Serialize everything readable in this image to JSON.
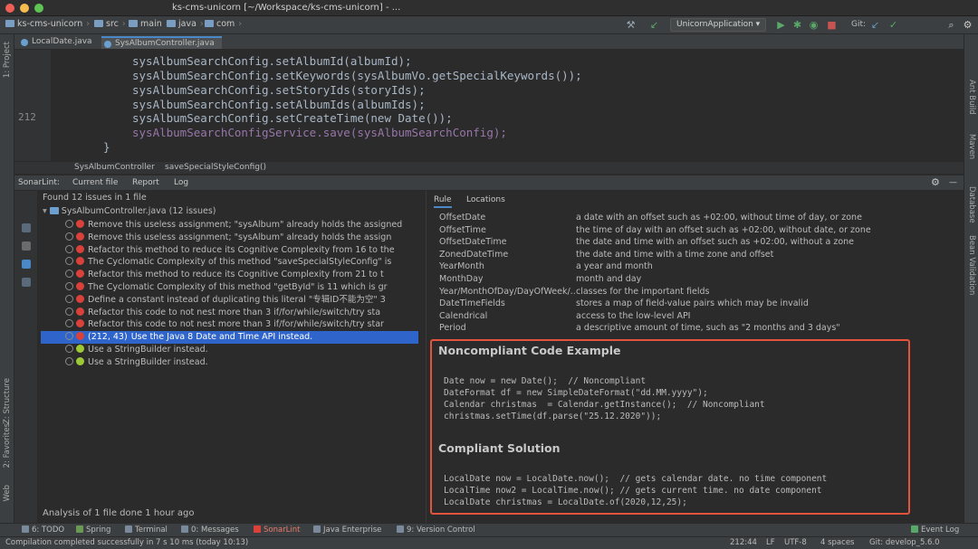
{
  "window": {
    "title": "ks-cms-unicorn [~/Workspace/ks-cms-unicorn] - ..."
  },
  "navbar": {
    "crumbs": [
      "ks-cms-unicorn",
      "src",
      "main",
      "java",
      "com"
    ],
    "run_config": "UnicornApplication",
    "git_label": "Git:"
  },
  "left_strip": {
    "project": "1: Project",
    "structure": "Z: Structure",
    "favorites": "2: Favorites",
    "web": "Web"
  },
  "right_strip": {
    "ant_build": "Ant Build",
    "maven": "Maven",
    "database": "Database",
    "bean_validation": "Bean Validation"
  },
  "editor": {
    "tabs": [
      {
        "label": "LocalDate.java",
        "color": "#6a9fcf"
      },
      {
        "label": "SysAlbumController.java",
        "color": "#6a9fcf"
      }
    ],
    "current_line_number": "212",
    "lines": [
      "sysAlbumSearchConfig.setAlbumId(albumId);",
      "sysAlbumSearchConfig.setKeywords(sysAlbumVo.getSpecialKeywords());",
      "sysAlbumSearchConfig.setStoryIds(storyIds);",
      "sysAlbumSearchConfig.setAlbumIds(albumIds);",
      "sysAlbumSearchConfig.setCreateTime(new Date());",
      "sysAlbumSearchConfigService.save(sysAlbumSearchConfig);",
      "}"
    ],
    "breadcrumbs": [
      "SysAlbumController",
      "saveSpecialStyleConfig()"
    ]
  },
  "sonarlint": {
    "tabs": [
      "SonarLint:",
      "Current file",
      "Report",
      "Log"
    ],
    "found": "Found 12 issues in 1 file",
    "file_node": "SysAlbumController.java  (12 issues)",
    "issues": [
      {
        "loc": "",
        "text": "Remove this useless assignment; \"sysAlbum\" already holds the assigned",
        "severity": "major"
      },
      {
        "loc": "",
        "text": "Remove this useless assignment; \"sysAlbum\" already holds the assign",
        "severity": "major"
      },
      {
        "loc": "",
        "text": "Refactor this method to reduce its Cognitive Complexity from 16 to the",
        "severity": "major"
      },
      {
        "loc": "",
        "text": "The Cyclomatic Complexity of this method \"saveSpecialStyleConfig\" is",
        "severity": "major"
      },
      {
        "loc": "",
        "text": "Refactor this method to reduce its Cognitive Complexity from 21 to t",
        "severity": "major"
      },
      {
        "loc": "",
        "text": "The Cyclomatic Complexity of this method \"getById\" is 11 which is gr",
        "severity": "major"
      },
      {
        "loc": "",
        "text": "Define a constant instead of duplicating this literal \"专辑ID不能为空\" 3",
        "severity": "major"
      },
      {
        "loc": "",
        "text": "Refactor this code to not nest more than 3 if/for/while/switch/try sta",
        "severity": "major"
      },
      {
        "loc": "",
        "text": "Refactor this code to not nest more than 3 if/for/while/switch/try star",
        "severity": "major"
      },
      {
        "loc": "(212, 43)",
        "text": "Use the Java 8 Date and Time API instead.",
        "severity": "major"
      },
      {
        "loc": "",
        "text": "Use a StringBuilder instead.",
        "severity": "minor"
      },
      {
        "loc": "",
        "text": "Use a StringBuilder instead.",
        "severity": "minor"
      }
    ],
    "analysis_status": "Analysis of 1 file done 1 hour ago"
  },
  "rule": {
    "tabs": [
      "Rule",
      "Locations"
    ],
    "datetime_table": [
      {
        "name": "OffsetDate",
        "desc": "a date with an offset such as +02:00, without time of day, or zone"
      },
      {
        "name": "OffsetTime",
        "desc": "the time of day with an offset such as +02:00, without date, or zone"
      },
      {
        "name": "OffsetDateTime",
        "desc": "the date and time with an offset such as +02:00, without a zone"
      },
      {
        "name": "ZonedDateTime",
        "desc": "the date and time with a time zone and offset"
      },
      {
        "name": "YearMonth",
        "desc": "a year and month"
      },
      {
        "name": "MonthDay",
        "desc": "month and day"
      },
      {
        "name": "Year/MonthOfDay/DayOfWeek/...",
        "desc": "classes for the important fields"
      },
      {
        "name": "DateTimeFields",
        "desc": "stores a map of field-value pairs which may be invalid"
      },
      {
        "name": "Calendrical",
        "desc": "access to the low-level API"
      },
      {
        "name": "Period",
        "desc": "a descriptive amount of time, such as \"2 months and 3 days\""
      }
    ],
    "noncompliant_title": "Noncompliant Code Example",
    "noncompliant_code": [
      "Date now = new Date();  // Noncompliant",
      "DateFormat df = new SimpleDateFormat(\"dd.MM.yyyy\");",
      "Calendar christmas  = Calendar.getInstance();  // Noncompliant",
      "christmas.setTime(df.parse(\"25.12.2020\"));"
    ],
    "compliant_title": "Compliant Solution",
    "compliant_code": [
      "LocalDate now = LocalDate.now();  // gets calendar date. no time component",
      "LocalTime now2 = LocalTime.now(); // gets current time. no date component",
      "LocalDate christmas = LocalDate.of(2020,12,25);"
    ]
  },
  "bottom_tabs": [
    "6: TODO",
    "Spring",
    "Terminal",
    "0: Messages",
    "SonarLint",
    "Java Enterprise",
    "9: Version Control",
    "Event Log"
  ],
  "status": {
    "message": "Compilation completed successfully in 7 s 10 ms (today 10:13)",
    "position": "212:44",
    "line_sep": "LF",
    "encoding": "UTF-8",
    "indent": "4 spaces",
    "branch": "Git: develop_5.6.0"
  },
  "colors": {
    "accent": "#2f65ca",
    "highlight_box": "#e5533d",
    "keyword": "#cc7832",
    "field": "#9876aa"
  }
}
